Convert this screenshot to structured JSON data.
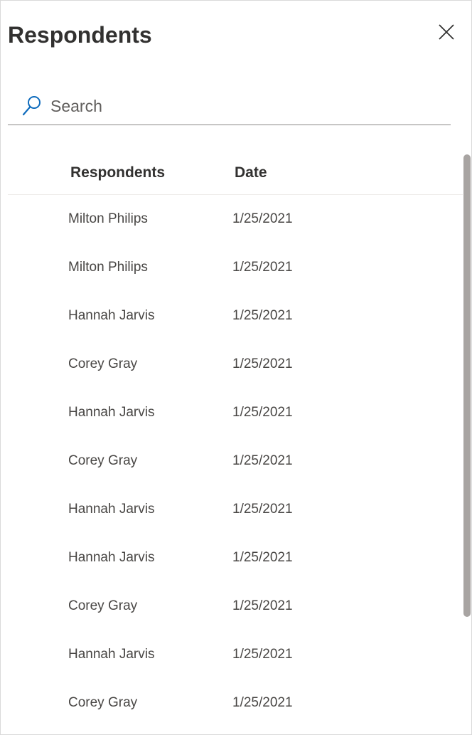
{
  "panel": {
    "title": "Respondents",
    "close_label": "Close"
  },
  "search": {
    "placeholder": "Search",
    "value": ""
  },
  "table": {
    "columns": [
      "Respondents",
      "Date"
    ],
    "rows": [
      {
        "name": "Milton Philips",
        "date": "1/25/2021"
      },
      {
        "name": "Milton Philips",
        "date": "1/25/2021"
      },
      {
        "name": "Hannah Jarvis",
        "date": "1/25/2021"
      },
      {
        "name": "Corey Gray",
        "date": "1/25/2021"
      },
      {
        "name": "Hannah Jarvis",
        "date": "1/25/2021"
      },
      {
        "name": "Corey Gray",
        "date": "1/25/2021"
      },
      {
        "name": "Hannah Jarvis",
        "date": "1/25/2021"
      },
      {
        "name": "Hannah Jarvis",
        "date": "1/25/2021"
      },
      {
        "name": "Corey Gray",
        "date": "1/25/2021"
      },
      {
        "name": "Hannah Jarvis",
        "date": "1/25/2021"
      },
      {
        "name": "Corey Gray",
        "date": "1/25/2021"
      }
    ]
  },
  "icons": {
    "close": "close-icon",
    "search": "search-icon"
  },
  "colors": {
    "accent": "#0f6cbd",
    "text": "#323130",
    "scrollbar": "#a8a4a2"
  }
}
